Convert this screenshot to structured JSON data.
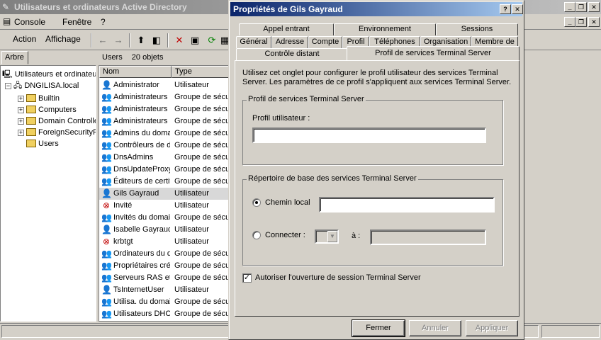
{
  "mmc": {
    "title": "Utilisateurs et ordinateurs Active Directory",
    "menu": [
      "Console",
      "Fenêtre",
      "?"
    ],
    "toolbar": {
      "action": "Action",
      "affichage": "Affichage"
    },
    "tree_tab": "Arbre",
    "tree": {
      "root": "Utilisateurs et ordinateurs",
      "domain": "DNGILISA.local",
      "children": [
        "Builtin",
        "Computers",
        "Domain Controllers",
        "ForeignSecurityPrincipals",
        "Users"
      ]
    },
    "list_header": {
      "container": "Users",
      "count": "20 objets"
    },
    "columns": [
      "Nom",
      "Type"
    ],
    "rows": [
      {
        "name": "Administrator",
        "type": "Utilisateur",
        "icon": "user-icon"
      },
      {
        "name": "Administrateurs de l'entreprise",
        "type": "Groupe de sécurité",
        "icon": "group-icon"
      },
      {
        "name": "Administrateurs du schéma",
        "type": "Groupe de sécurité",
        "icon": "group-icon"
      },
      {
        "name": "Administrateurs DHCP",
        "type": "Groupe de sécurité",
        "icon": "group-icon"
      },
      {
        "name": "Admins du domaine",
        "type": "Groupe de sécurité",
        "icon": "group-icon"
      },
      {
        "name": "Contrôleurs de domaine",
        "type": "Groupe de sécurité",
        "icon": "group-icon"
      },
      {
        "name": "DnsAdmins",
        "type": "Groupe de sécurité",
        "icon": "group-icon"
      },
      {
        "name": "DnsUpdateProxy",
        "type": "Groupe de sécurité",
        "icon": "group-icon"
      },
      {
        "name": "Éditeurs de certificats",
        "type": "Groupe de sécurité",
        "icon": "group-icon"
      },
      {
        "name": "Gils Gayraud",
        "type": "Utilisateur",
        "icon": "user-icon"
      },
      {
        "name": "Invité",
        "type": "Utilisateur",
        "icon": "disabled-user-icon"
      },
      {
        "name": "Invités du domaine",
        "type": "Groupe de sécurité",
        "icon": "group-icon"
      },
      {
        "name": "Isabelle Gayraud",
        "type": "Utilisateur",
        "icon": "user-icon"
      },
      {
        "name": "krbtgt",
        "type": "Utilisateur",
        "icon": "disabled-user-icon"
      },
      {
        "name": "Ordinateurs du domaine",
        "type": "Groupe de sécurité",
        "icon": "group-icon"
      },
      {
        "name": "Propriétaires créateurs",
        "type": "Groupe de sécurité",
        "icon": "group-icon"
      },
      {
        "name": "Serveurs RAS et IAS",
        "type": "Groupe de sécurité",
        "icon": "group-icon"
      },
      {
        "name": "TsInternetUser",
        "type": "Utilisateur",
        "icon": "user-icon"
      },
      {
        "name": "Utilisa. du domaine",
        "type": "Groupe de sécurité",
        "icon": "group-icon"
      },
      {
        "name": "Utilisateurs DHCP",
        "type": "Groupe de sécurité",
        "icon": "group-icon"
      }
    ]
  },
  "dialog": {
    "title": "Propriétés de Gils Gayraud",
    "tabs_row1": [
      "Appel entrant",
      "Environnement",
      "Sessions"
    ],
    "tabs_row2": [
      "Général",
      "Adresse",
      "Compte",
      "Profil",
      "Téléphones",
      "Organisation",
      "Membre de"
    ],
    "tabs_row3": [
      "Contrôle distant",
      "Profil de services Terminal Server"
    ],
    "description": "Utilisez cet onglet pour configurer le profil utilisateur des services Terminal Server. Les paramètres de ce profil s'appliquent aux services Terminal Server.",
    "profile_group": {
      "label": "Profil de services Terminal Server",
      "field_label": "Profil utilisateur :",
      "value": ""
    },
    "home_group": {
      "label": "Répertoire de base des services Terminal Server",
      "local_label": "Chemin local",
      "local_value": "",
      "connect_label": "Connecter :",
      "to_label": "à :",
      "to_value": ""
    },
    "allow_logon": {
      "label": "Autoriser l'ouverture de session Terminal Server",
      "checked": true
    },
    "buttons": {
      "close": "Fermer",
      "cancel": "Annuler",
      "apply": "Appliquer"
    }
  }
}
